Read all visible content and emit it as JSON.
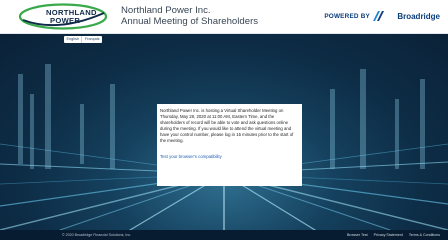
{
  "header": {
    "logo_line1": "NORTHLAND",
    "logo_line2": "POWER",
    "company": "Northland Power Inc.",
    "meeting": "Annual Meeting of Shareholders",
    "powered_by": "POWERED BY",
    "powered_brand": "Broadridge"
  },
  "language": {
    "english": "English",
    "french": "Français"
  },
  "notice": {
    "text": "Northland Power Inc. is hosting a Virtual Shareholder Meeting on Thursday, May 28, 2020 at 11:00 AM, Eastern Time, and the shareholders of record will be able to vote and ask questions online during the meeting. If you would like to attend the virtual meeting and have your control number, please log in 15 minutes prior to the start of the meeting.",
    "link": "Test your browser's compatibility"
  },
  "footer": {
    "copyright": "© 2020 Broadridge Financial Solutions, Inc.",
    "links": [
      "Browser Test",
      "Privacy Statement",
      "Terms & Conditions"
    ]
  },
  "colors": {
    "brand_navy": "#0f2a4a",
    "logo_green": "#3aa94b",
    "broadridge_blue": "#0a3d7a",
    "link_blue": "#1f5fb5"
  }
}
